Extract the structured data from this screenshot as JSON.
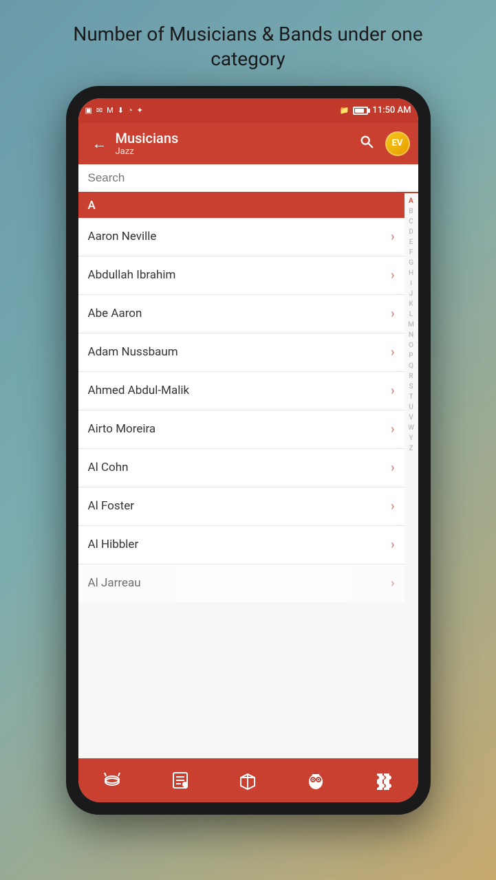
{
  "page": {
    "title": "Number of Musicians & Bands under one category"
  },
  "statusBar": {
    "time": "11:50 AM",
    "icons": [
      "📶",
      "📧",
      "⬇",
      "🔔",
      "🤖"
    ]
  },
  "appBar": {
    "title": "Musicians",
    "subtitle": "Jazz",
    "backLabel": "←",
    "searchLabel": "🔍",
    "logoText": "EV"
  },
  "search": {
    "placeholder": "Search"
  },
  "sections": [
    {
      "letter": "A",
      "items": [
        "Aaron Neville",
        "Abdullah Ibrahim",
        "Abe Aaron",
        "Adam Nussbaum",
        "Ahmed Abdul-Malik",
        "Airto Moreira",
        "Al Cohn",
        "Al Foster",
        "Al Hibbler",
        "Al Jarreau"
      ]
    }
  ],
  "alphabet": [
    "A",
    "B",
    "C",
    "D",
    "E",
    "F",
    "G",
    "H",
    "I",
    "J",
    "K",
    "L",
    "M",
    "N",
    "O",
    "P",
    "Q",
    "R",
    "S",
    "T",
    "U",
    "V",
    "W",
    "Y",
    "Z"
  ],
  "bottomNav": [
    {
      "icon": "🥁",
      "name": "drums"
    },
    {
      "icon": "📋",
      "name": "list"
    },
    {
      "icon": "📦",
      "name": "box"
    },
    {
      "icon": "🦉",
      "name": "owl"
    },
    {
      "icon": "🧩",
      "name": "puzzle"
    }
  ]
}
